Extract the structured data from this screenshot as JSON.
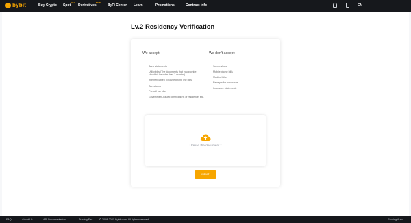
{
  "brand": {
    "name": "bybit"
  },
  "nav": {
    "items": [
      {
        "label": "Buy Crypto",
        "has_caret": false
      },
      {
        "label": "Spot",
        "has_caret": false,
        "badge": "Hot"
      },
      {
        "label": "Derivatives",
        "has_caret": true,
        "badge": "NEW"
      },
      {
        "label": "ByFi Center",
        "has_caret": false
      },
      {
        "label": "Learn",
        "has_caret": true
      },
      {
        "label": "Promotions",
        "has_caret": true
      },
      {
        "label": "Contract Info",
        "has_caret": true
      }
    ],
    "icons": [
      "bell-icon",
      "phone-icon"
    ],
    "language": "EN"
  },
  "page": {
    "title": "Lv.2 Residency Verification",
    "accept": {
      "heading": "We accept:",
      "items": [
        "Bank statements",
        "Utility bills (The documents that you provide shouldn't be older than 3 months)",
        "Internet/cable TV/house phone line bills",
        "Tax returns",
        "Council tax bills",
        "Government-issued certifications of residence, etc."
      ]
    },
    "reject": {
      "heading": "We don't accept:",
      "items": [
        "Screenshots",
        "Mobile phone bills",
        "Medical bills",
        "Receipts for purchases",
        "Insurance statements"
      ]
    },
    "upload": {
      "label": "Upload the document *",
      "icon": "cloud-upload-icon"
    },
    "next_button": "NEXT"
  },
  "footer": {
    "links": [
      "FAQ",
      "About Us",
      "API Documentation",
      "Trading Fee"
    ],
    "copyright": "© 2018-2021 Bybit.com. All rights reserved.",
    "right_text": "Routing Auto"
  },
  "colors": {
    "accent": "#f7a600",
    "nav_bg": "#16181c"
  }
}
